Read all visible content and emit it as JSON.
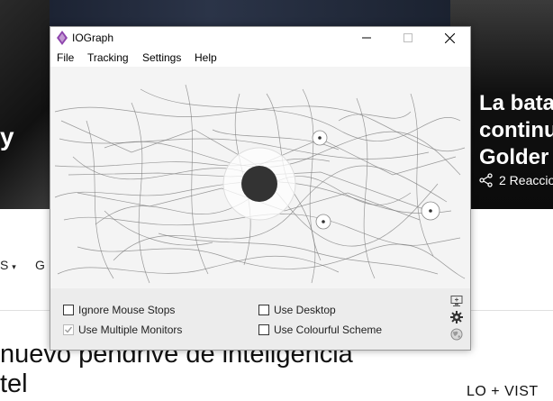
{
  "background": {
    "hero_letter": "y",
    "hero_title": "La bata\ncontinu\nGolder",
    "share_text": "2 Reaccio",
    "nav_items": [
      "S",
      "G"
    ],
    "article_title": "nuevo pendrive de inteligencia\ntel",
    "side_label": "LO + VIST"
  },
  "window": {
    "title": "IOGraph",
    "menu": [
      "File",
      "Tracking",
      "Settings",
      "Help"
    ],
    "options": {
      "ignore_mouse_stops": {
        "label": "Ignore Mouse Stops",
        "checked": false
      },
      "use_multiple_monitors": {
        "label": "Use Multiple Monitors",
        "checked": true
      },
      "use_desktop": {
        "label": "Use Desktop",
        "checked": false
      },
      "use_colourful_scheme": {
        "label": "Use Colourful Scheme",
        "checked": false
      }
    },
    "icons": [
      "minimize-icon",
      "maximize-icon",
      "close-icon",
      "monitor-icon",
      "gear-icon",
      "globe-icon"
    ]
  },
  "colors": {
    "canvas_bg": "#f4f4f4",
    "panel_bg": "#ececec",
    "trace": "#7a7a7a",
    "dot": "#333333",
    "app_icon": "#8e44ad"
  }
}
